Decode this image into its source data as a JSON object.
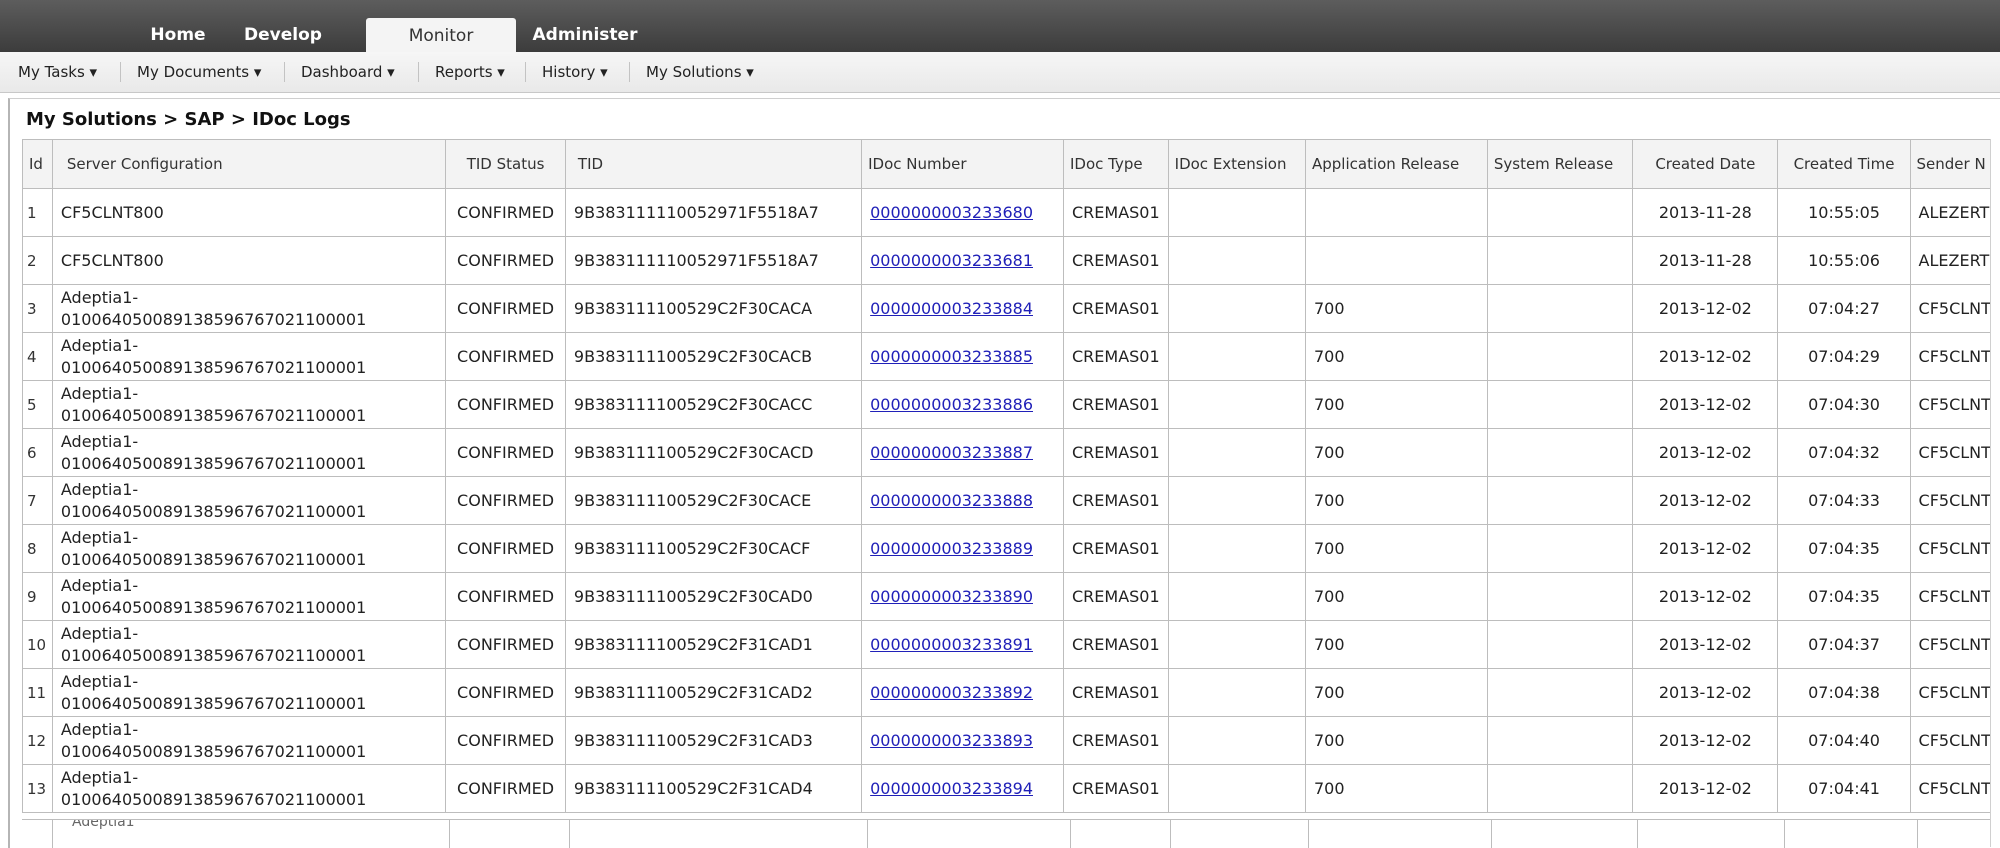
{
  "top_tabs": [
    {
      "label": "Home",
      "active": false
    },
    {
      "label": "Develop",
      "active": false
    },
    {
      "label": "Monitor",
      "active": true
    },
    {
      "label": "Administer",
      "active": false
    }
  ],
  "menu": [
    "My Tasks ▾",
    "My Documents ▾",
    "Dashboard ▾",
    "Reports ▾",
    "History ▾",
    "My Solutions ▾"
  ],
  "breadcrumb": "My Solutions > SAP > IDoc Logs",
  "columns": [
    "Id",
    "Server Configuration",
    "TID Status",
    "TID",
    "IDoc Number",
    "IDoc Type",
    "IDoc Extension",
    "Application Release",
    "System Release",
    "Created Date",
    "Created Time",
    "Sender N"
  ],
  "rows": [
    {
      "id": "1",
      "cfg1": "CF5CLNT800",
      "cfg2": "",
      "status": "CONFIRMED",
      "tid": "9B383111110052971F5518A7",
      "idoc": "0000000003233680",
      "type": "CREMAS01",
      "ext": "",
      "app_rel": "",
      "sys_rel": "",
      "date": "2013-11-28",
      "time": "10:55:05",
      "sender": "ALEZERT"
    },
    {
      "id": "2",
      "cfg1": "CF5CLNT800",
      "cfg2": "",
      "status": "CONFIRMED",
      "tid": "9B383111110052971F5518A7",
      "idoc": "0000000003233681",
      "type": "CREMAS01",
      "ext": "",
      "app_rel": "",
      "sys_rel": "",
      "date": "2013-11-28",
      "time": "10:55:06",
      "sender": "ALEZERT"
    },
    {
      "id": "3",
      "cfg1": "Adeptia1-",
      "cfg2": "010064050089138596767021100001",
      "status": "CONFIRMED",
      "tid": "9B383111100529C2F30CACA",
      "idoc": "0000000003233884",
      "type": "CREMAS01",
      "ext": "",
      "app_rel": "700",
      "sys_rel": "",
      "date": "2013-12-02",
      "time": "07:04:27",
      "sender": "CF5CLNT"
    },
    {
      "id": "4",
      "cfg1": "Adeptia1-",
      "cfg2": "010064050089138596767021100001",
      "status": "CONFIRMED",
      "tid": "9B383111100529C2F30CACB",
      "idoc": "0000000003233885",
      "type": "CREMAS01",
      "ext": "",
      "app_rel": "700",
      "sys_rel": "",
      "date": "2013-12-02",
      "time": "07:04:29",
      "sender": "CF5CLNT"
    },
    {
      "id": "5",
      "cfg1": "Adeptia1-",
      "cfg2": "010064050089138596767021100001",
      "status": "CONFIRMED",
      "tid": "9B383111100529C2F30CACC",
      "idoc": "0000000003233886",
      "type": "CREMAS01",
      "ext": "",
      "app_rel": "700",
      "sys_rel": "",
      "date": "2013-12-02",
      "time": "07:04:30",
      "sender": "CF5CLNT"
    },
    {
      "id": "6",
      "cfg1": "Adeptia1-",
      "cfg2": "010064050089138596767021100001",
      "status": "CONFIRMED",
      "tid": "9B383111100529C2F30CACD",
      "idoc": "0000000003233887",
      "type": "CREMAS01",
      "ext": "",
      "app_rel": "700",
      "sys_rel": "",
      "date": "2013-12-02",
      "time": "07:04:32",
      "sender": "CF5CLNT"
    },
    {
      "id": "7",
      "cfg1": "Adeptia1-",
      "cfg2": "010064050089138596767021100001",
      "status": "CONFIRMED",
      "tid": "9B383111100529C2F30CACE",
      "idoc": "0000000003233888",
      "type": "CREMAS01",
      "ext": "",
      "app_rel": "700",
      "sys_rel": "",
      "date": "2013-12-02",
      "time": "07:04:33",
      "sender": "CF5CLNT"
    },
    {
      "id": "8",
      "cfg1": "Adeptia1-",
      "cfg2": "010064050089138596767021100001",
      "status": "CONFIRMED",
      "tid": "9B383111100529C2F30CACF",
      "idoc": "0000000003233889",
      "type": "CREMAS01",
      "ext": "",
      "app_rel": "700",
      "sys_rel": "",
      "date": "2013-12-02",
      "time": "07:04:35",
      "sender": "CF5CLNT"
    },
    {
      "id": "9",
      "cfg1": "Adeptia1-",
      "cfg2": "010064050089138596767021100001",
      "status": "CONFIRMED",
      "tid": "9B383111100529C2F30CAD0",
      "idoc": "0000000003233890",
      "type": "CREMAS01",
      "ext": "",
      "app_rel": "700",
      "sys_rel": "",
      "date": "2013-12-02",
      "time": "07:04:35",
      "sender": "CF5CLNT"
    },
    {
      "id": "10",
      "cfg1": "Adeptia1-",
      "cfg2": "010064050089138596767021100001",
      "status": "CONFIRMED",
      "tid": "9B383111100529C2F31CAD1",
      "idoc": "0000000003233891",
      "type": "CREMAS01",
      "ext": "",
      "app_rel": "700",
      "sys_rel": "",
      "date": "2013-12-02",
      "time": "07:04:37",
      "sender": "CF5CLNT"
    },
    {
      "id": "11",
      "cfg1": "Adeptia1-",
      "cfg2": "010064050089138596767021100001",
      "status": "CONFIRMED",
      "tid": "9B383111100529C2F31CAD2",
      "idoc": "0000000003233892",
      "type": "CREMAS01",
      "ext": "",
      "app_rel": "700",
      "sys_rel": "",
      "date": "2013-12-02",
      "time": "07:04:38",
      "sender": "CF5CLNT"
    },
    {
      "id": "12",
      "cfg1": "Adeptia1-",
      "cfg2": "010064050089138596767021100001",
      "status": "CONFIRMED",
      "tid": "9B383111100529C2F31CAD3",
      "idoc": "0000000003233893",
      "type": "CREMAS01",
      "ext": "",
      "app_rel": "700",
      "sys_rel": "",
      "date": "2013-12-02",
      "time": "07:04:40",
      "sender": "CF5CLNT"
    },
    {
      "id": "13",
      "cfg1": "Adeptia1-",
      "cfg2": "010064050089138596767021100001",
      "status": "CONFIRMED",
      "tid": "9B383111100529C2F31CAD4",
      "idoc": "0000000003233894",
      "type": "CREMAS01",
      "ext": "",
      "app_rel": "700",
      "sys_rel": "",
      "date": "2013-12-02",
      "time": "07:04:41",
      "sender": "CF5CLNT"
    }
  ],
  "partial_row_text": "Adeptia1"
}
